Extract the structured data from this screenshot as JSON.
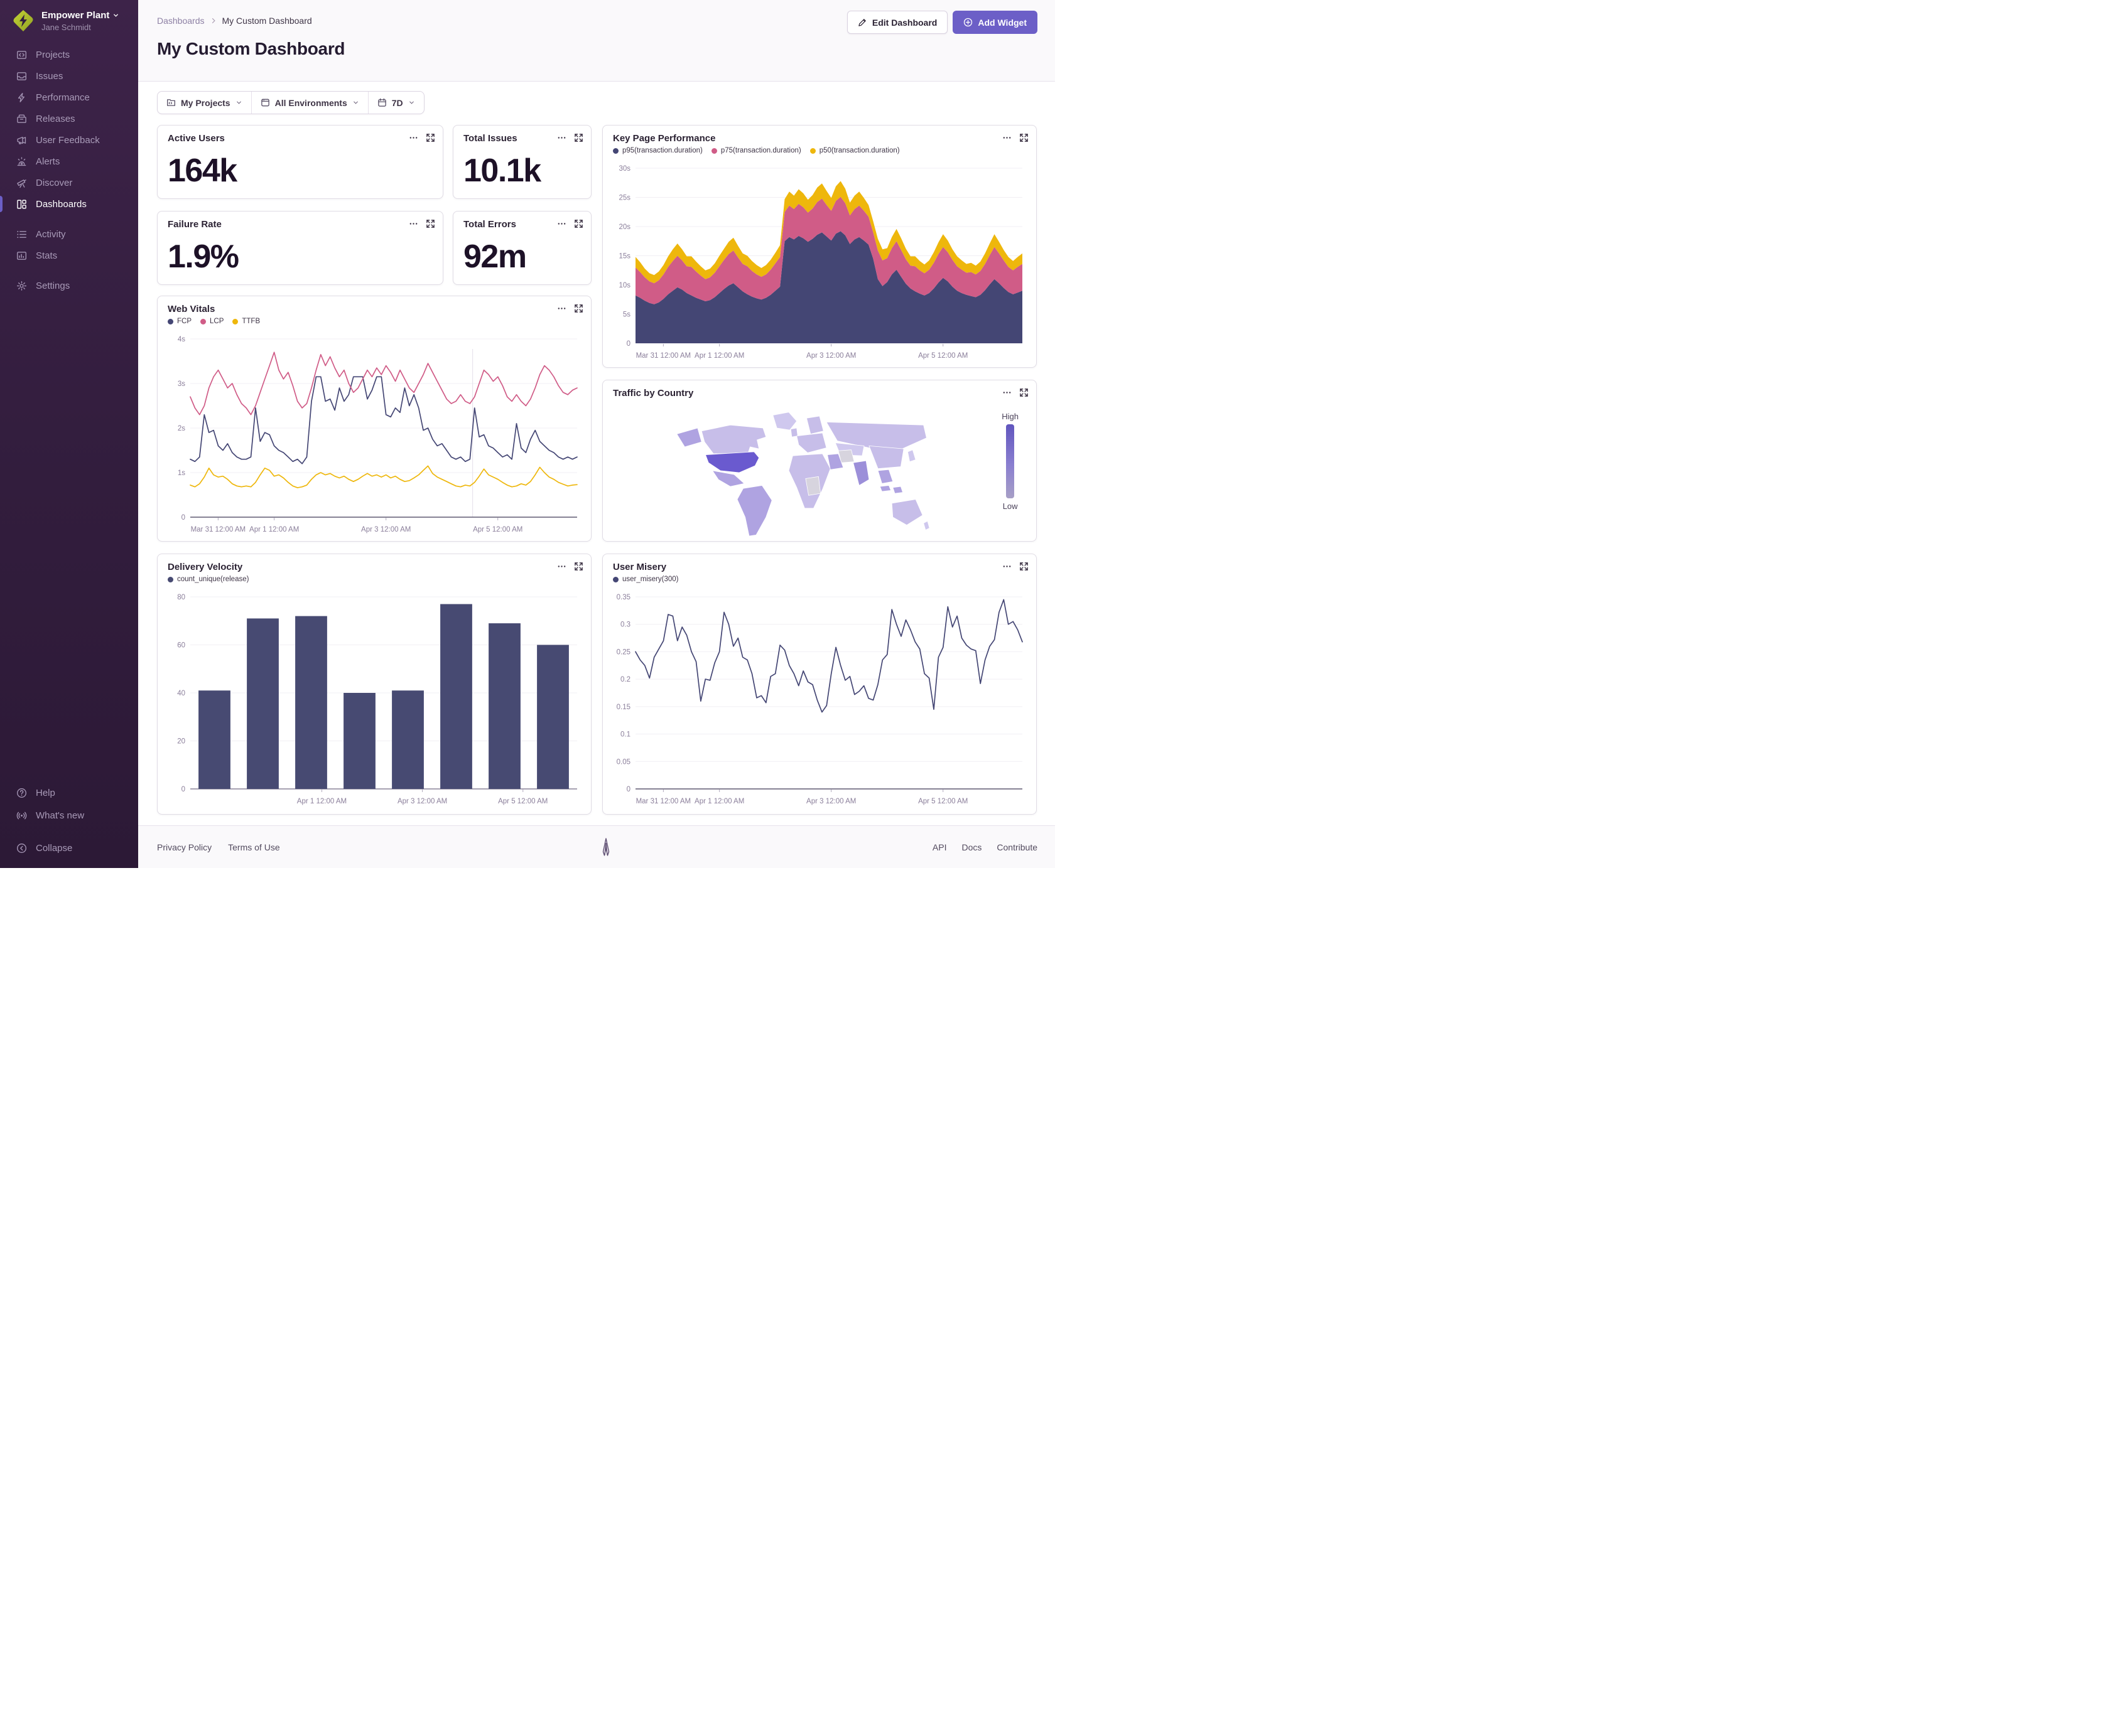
{
  "colors": {
    "accent": "#6C5FC7",
    "navy": "#444674",
    "pink": "#D05C87",
    "gold": "#EEB70C",
    "bar": "#474A72"
  },
  "sidebar": {
    "org_name": "Empower Plant",
    "user_name": "Jane Schmidt",
    "items": [
      {
        "label": "Projects"
      },
      {
        "label": "Issues"
      },
      {
        "label": "Performance"
      },
      {
        "label": "Releases"
      },
      {
        "label": "User Feedback"
      },
      {
        "label": "Alerts"
      },
      {
        "label": "Discover"
      },
      {
        "label": "Dashboards"
      },
      {
        "label": "Activity"
      },
      {
        "label": "Stats"
      },
      {
        "label": "Settings"
      }
    ],
    "footer_items": [
      {
        "label": "Help"
      },
      {
        "label": "What's new"
      },
      {
        "label": "Collapse"
      }
    ]
  },
  "header": {
    "breadcrumb_parent": "Dashboards",
    "breadcrumb_current": "My Custom Dashboard",
    "title": "My Custom Dashboard",
    "edit_button": "Edit Dashboard",
    "add_button": "Add Widget"
  },
  "filters": {
    "projects": "My Projects",
    "environments": "All Environments",
    "date_range": "7D"
  },
  "stat_cards": [
    {
      "title": "Active Users",
      "value": "164k"
    },
    {
      "title": "Total Issues",
      "value": "10.1k"
    },
    {
      "title": "Failure Rate",
      "value": "1.9%"
    },
    {
      "title": "Total Errors",
      "value": "92m"
    }
  ],
  "footer": {
    "links_left": [
      "Privacy Policy",
      "Terms of Use"
    ],
    "links_right": [
      "API",
      "Docs",
      "Contribute"
    ]
  },
  "chart_data": [
    {
      "id": "key_page_performance",
      "type": "area",
      "stacked": true,
      "title": "Key Page Performance",
      "ylabel": "seconds",
      "ylim": [
        0,
        30
      ],
      "y_ticks": [
        {
          "v": 0,
          "label": "0"
        },
        {
          "v": 5,
          "label": "5s"
        },
        {
          "v": 10,
          "label": "10s"
        },
        {
          "v": 15,
          "label": "15s"
        },
        {
          "v": 20,
          "label": "20s"
        },
        {
          "v": 25,
          "label": "25s"
        },
        {
          "v": 30,
          "label": "30s"
        }
      ],
      "x_ticks": [
        {
          "f": 0.072,
          "label": "Mar 31 12:00 AM"
        },
        {
          "f": 0.217,
          "label": "Apr 1 12:00 AM"
        },
        {
          "f": 0.506,
          "label": "Apr 3 12:00 AM"
        },
        {
          "f": 0.795,
          "label": "Apr 5 12:00 AM"
        }
      ],
      "series": [
        {
          "name": "p95(transaction.duration)",
          "color": "#444674",
          "values": [
            8.2,
            7.8,
            7.3,
            6.9,
            6.7,
            7.0,
            7.6,
            8.4,
            9.0,
            9.6,
            9.2,
            8.6,
            8.2,
            7.8,
            7.5,
            7.2,
            7.4,
            7.9,
            8.6,
            9.3,
            9.9,
            10.3,
            9.6,
            8.9,
            8.4,
            8.0,
            7.7,
            7.5,
            7.8,
            8.3,
            9.0,
            9.7,
            17.5,
            18.2,
            17.8,
            18.4,
            18.0,
            17.4,
            17.9,
            18.6,
            19.0,
            18.3,
            17.6,
            18.8,
            19.2,
            18.5,
            17.0,
            17.8,
            18.2,
            17.6,
            16.9,
            14.5,
            11.0,
            9.8,
            10.5,
            11.8,
            12.6,
            11.4,
            10.2,
            9.4,
            8.9,
            8.5,
            8.2,
            8.6,
            9.4,
            10.4,
            11.2,
            10.6,
            9.7,
            9.0,
            8.6,
            8.3,
            8.1,
            7.9,
            8.3,
            9.1,
            10.1,
            11.0,
            10.3,
            9.5,
            8.8,
            8.4,
            8.7,
            9.0
          ]
        },
        {
          "name": "p75(transaction.duration)",
          "color": "#D05C87",
          "values": [
            4.8,
            4.4,
            4.0,
            3.7,
            3.6,
            3.8,
            4.2,
            4.7,
            5.1,
            5.4,
            5.0,
            4.6,
            4.9,
            4.5,
            4.1,
            3.8,
            3.9,
            4.2,
            4.6,
            5.0,
            5.4,
            5.6,
            5.1,
            4.7,
            4.8,
            4.4,
            4.1,
            3.9,
            4.0,
            4.3,
            4.7,
            5.1,
            5.0,
            5.4,
            5.2,
            5.5,
            5.3,
            5.0,
            5.2,
            5.6,
            5.8,
            5.4,
            5.1,
            5.6,
            5.9,
            5.5,
            4.9,
            5.2,
            5.4,
            5.1,
            4.8,
            4.5,
            4.9,
            4.4,
            4.1,
            4.5,
            4.9,
            4.6,
            4.2,
            3.9,
            4.3,
            4.0,
            3.8,
            4.0,
            4.4,
            4.9,
            5.3,
            5.0,
            4.6,
            4.2,
            4.0,
            3.8,
            4.1,
            3.9,
            4.1,
            4.5,
            5.0,
            5.5,
            5.1,
            4.7,
            4.3,
            4.1,
            4.4,
            4.6
          ]
        },
        {
          "name": "p50(transaction.duration)",
          "color": "#EEB70C",
          "values": [
            1.8,
            1.7,
            1.5,
            1.4,
            1.4,
            1.5,
            1.6,
            1.8,
            2.0,
            2.1,
            1.9,
            1.7,
            1.8,
            1.7,
            1.6,
            1.5,
            1.5,
            1.6,
            1.8,
            1.9,
            2.1,
            2.2,
            2.0,
            1.8,
            1.8,
            1.7,
            1.6,
            1.5,
            1.6,
            1.7,
            1.8,
            2.0,
            2.2,
            2.4,
            2.3,
            2.5,
            2.4,
            2.2,
            2.3,
            2.5,
            2.6,
            2.4,
            2.2,
            2.5,
            2.7,
            2.5,
            2.2,
            2.3,
            2.4,
            2.2,
            2.0,
            1.9,
            2.0,
            1.9,
            1.7,
            1.9,
            2.1,
            2.0,
            1.8,
            1.6,
            1.7,
            1.6,
            1.5,
            1.6,
            1.8,
            2.0,
            2.2,
            2.0,
            1.8,
            1.7,
            1.6,
            1.5,
            1.6,
            1.5,
            1.6,
            1.8,
            2.0,
            2.2,
            2.0,
            1.8,
            1.7,
            1.6,
            1.7,
            1.8
          ]
        }
      ]
    },
    {
      "id": "web_vitals",
      "type": "line",
      "title": "Web Vitals",
      "ylim": [
        0,
        4
      ],
      "marker_f": 0.73,
      "y_ticks": [
        {
          "v": 0,
          "label": "0"
        },
        {
          "v": 1,
          "label": "1s"
        },
        {
          "v": 2,
          "label": "2s"
        },
        {
          "v": 3,
          "label": "3s"
        },
        {
          "v": 4,
          "label": "4s"
        }
      ],
      "x_ticks": [
        {
          "f": 0.072,
          "label": "Mar 31 12:00 AM"
        },
        {
          "f": 0.217,
          "label": "Apr 1 12:00 AM"
        },
        {
          "f": 0.506,
          "label": "Apr 3 12:00 AM"
        },
        {
          "f": 0.795,
          "label": "Apr 5 12:00 AM"
        }
      ],
      "series": [
        {
          "name": "FCP",
          "color": "#444674",
          "values": [
            1.3,
            1.25,
            1.35,
            2.3,
            1.9,
            1.95,
            1.6,
            1.5,
            1.65,
            1.45,
            1.35,
            1.3,
            1.3,
            1.35,
            2.45,
            1.7,
            1.9,
            1.85,
            1.6,
            1.5,
            1.45,
            1.35,
            1.25,
            1.3,
            1.2,
            1.35,
            2.6,
            3.15,
            3.15,
            2.6,
            2.65,
            2.4,
            2.9,
            2.6,
            2.75,
            3.15,
            3.15,
            3.15,
            2.65,
            2.85,
            3.15,
            3.15,
            2.3,
            2.25,
            2.45,
            2.35,
            2.9,
            2.5,
            2.75,
            2.45,
            1.95,
            2.0,
            1.75,
            1.6,
            1.65,
            1.5,
            1.35,
            1.3,
            1.35,
            1.25,
            1.3,
            2.45,
            1.8,
            1.85,
            1.6,
            1.55,
            1.45,
            1.35,
            1.4,
            1.3,
            2.1,
            1.55,
            1.45,
            1.75,
            1.95,
            1.7,
            1.6,
            1.5,
            1.45,
            1.35,
            1.3,
            1.35,
            1.3,
            1.35
          ]
        },
        {
          "name": "LCP",
          "color": "#D05C87",
          "values": [
            2.7,
            2.45,
            2.3,
            2.5,
            2.9,
            3.15,
            3.3,
            3.1,
            2.9,
            3.0,
            2.75,
            2.55,
            2.45,
            2.3,
            2.5,
            2.8,
            3.1,
            3.4,
            3.7,
            3.3,
            3.1,
            3.25,
            2.95,
            2.6,
            2.45,
            2.55,
            2.9,
            3.3,
            3.65,
            3.4,
            3.6,
            3.35,
            3.15,
            3.3,
            3.0,
            2.8,
            2.9,
            3.1,
            3.3,
            3.15,
            3.35,
            3.2,
            3.4,
            3.25,
            3.05,
            3.3,
            3.1,
            2.9,
            2.8,
            3.0,
            3.2,
            3.45,
            3.25,
            3.05,
            2.85,
            2.65,
            2.55,
            2.6,
            2.75,
            2.6,
            2.55,
            2.7,
            3.0,
            3.3,
            3.2,
            3.05,
            3.15,
            2.95,
            2.7,
            2.6,
            2.75,
            2.6,
            2.5,
            2.65,
            2.9,
            3.2,
            3.4,
            3.3,
            3.15,
            2.95,
            2.8,
            2.75,
            2.85,
            2.9
          ]
        },
        {
          "name": "TTFB",
          "color": "#EEB70C",
          "values": [
            0.72,
            0.68,
            0.75,
            0.9,
            1.1,
            0.95,
            0.9,
            0.92,
            0.85,
            0.75,
            0.7,
            0.68,
            0.7,
            0.68,
            0.78,
            0.95,
            1.1,
            1.05,
            0.92,
            0.95,
            0.88,
            0.78,
            0.7,
            0.66,
            0.68,
            0.72,
            0.85,
            0.95,
            1.0,
            0.95,
            0.98,
            0.92,
            0.88,
            0.92,
            0.85,
            0.8,
            0.85,
            0.92,
            0.98,
            0.92,
            0.95,
            0.9,
            0.95,
            0.88,
            0.92,
            0.85,
            0.8,
            0.82,
            0.88,
            0.95,
            1.05,
            1.15,
            0.98,
            0.9,
            0.85,
            0.8,
            0.75,
            0.7,
            0.68,
            0.72,
            0.7,
            0.78,
            0.92,
            1.08,
            0.95,
            0.9,
            0.85,
            0.78,
            0.72,
            0.68,
            0.7,
            0.75,
            0.72,
            0.8,
            0.95,
            1.12,
            1.0,
            0.9,
            0.85,
            0.78,
            0.74,
            0.7,
            0.72,
            0.73
          ]
        }
      ]
    },
    {
      "id": "traffic_map",
      "type": "choropleth_map",
      "title": "Traffic by Country",
      "legend_high": "High",
      "legend_low": "Low",
      "palette": {
        "base": "#C7BEE9",
        "light": "#CFC8EE",
        "mid": "#AFA3E1",
        "middark": "#9C8FD9",
        "dark": "#6A5ACF",
        "gray": "#D7D4DE"
      },
      "regions": [
        {
          "id": "greenland",
          "level": "light"
        },
        {
          "id": "canada",
          "level": "base"
        },
        {
          "id": "alaska",
          "level": "mid"
        },
        {
          "id": "us",
          "level": "dark"
        },
        {
          "id": "mexico",
          "level": "mid"
        },
        {
          "id": "south_america",
          "level": "mid"
        },
        {
          "id": "scandinavia",
          "level": "base"
        },
        {
          "id": "uk",
          "level": "base"
        },
        {
          "id": "europe",
          "level": "base"
        },
        {
          "id": "africa",
          "level": "base"
        },
        {
          "id": "africa_gray",
          "level": "gray"
        },
        {
          "id": "russia",
          "level": "base"
        },
        {
          "id": "central_asia",
          "level": "light"
        },
        {
          "id": "iran",
          "level": "gray"
        },
        {
          "id": "saudi",
          "level": "mid"
        },
        {
          "id": "india",
          "level": "middark"
        },
        {
          "id": "china",
          "level": "base"
        },
        {
          "id": "se_asia",
          "level": "mid"
        },
        {
          "id": "japan",
          "level": "light"
        },
        {
          "id": "indonesia",
          "level": "mid"
        },
        {
          "id": "australia",
          "level": "base"
        },
        {
          "id": "new_zealand",
          "level": "light"
        }
      ]
    },
    {
      "id": "delivery_velocity",
      "type": "bar",
      "title": "Delivery Velocity",
      "color": "#474A72",
      "ylim": [
        0,
        80
      ],
      "y_ticks": [
        {
          "v": 0,
          "label": "0"
        },
        {
          "v": 20,
          "label": "20"
        },
        {
          "v": 40,
          "label": "40"
        },
        {
          "v": 60,
          "label": "60"
        },
        {
          "v": 80,
          "label": "80"
        }
      ],
      "x_ticks": [
        {
          "f": 0.34,
          "label": "Apr 1 12:00 AM"
        },
        {
          "f": 0.6,
          "label": "Apr 3 12:00 AM"
        },
        {
          "f": 0.86,
          "label": "Apr 5 12:00 AM"
        }
      ],
      "series": [
        {
          "name": "count_unique(release)",
          "color": "#474A72"
        }
      ],
      "values": [
        41,
        71,
        72,
        40,
        41,
        77,
        69,
        60
      ]
    },
    {
      "id": "user_misery",
      "type": "line",
      "title": "User Misery",
      "ylim": [
        0,
        0.35
      ],
      "y_ticks": [
        {
          "v": 0,
          "label": "0"
        },
        {
          "v": 0.05,
          "label": "0.05"
        },
        {
          "v": 0.1,
          "label": "0.1"
        },
        {
          "v": 0.15,
          "label": "0.15"
        },
        {
          "v": 0.2,
          "label": "0.2"
        },
        {
          "v": 0.25,
          "label": "0.25"
        },
        {
          "v": 0.3,
          "label": "0.3"
        },
        {
          "v": 0.35,
          "label": "0.35"
        }
      ],
      "x_ticks": [
        {
          "f": 0.072,
          "label": "Mar 31 12:00 AM"
        },
        {
          "f": 0.217,
          "label": "Apr 1 12:00 AM"
        },
        {
          "f": 0.506,
          "label": "Apr 3 12:00 AM"
        },
        {
          "f": 0.795,
          "label": "Apr 5 12:00 AM"
        }
      ],
      "series": [
        {
          "name": "user_misery(300)",
          "color": "#444674",
          "values": [
            0.25,
            0.235,
            0.225,
            0.202,
            0.24,
            0.255,
            0.27,
            0.318,
            0.315,
            0.27,
            0.295,
            0.28,
            0.25,
            0.232,
            0.16,
            0.2,
            0.198,
            0.23,
            0.25,
            0.322,
            0.3,
            0.26,
            0.275,
            0.24,
            0.235,
            0.21,
            0.166,
            0.17,
            0.157,
            0.205,
            0.21,
            0.262,
            0.253,
            0.225,
            0.21,
            0.188,
            0.215,
            0.195,
            0.19,
            0.162,
            0.14,
            0.152,
            0.21,
            0.258,
            0.225,
            0.198,
            0.205,
            0.172,
            0.178,
            0.188,
            0.165,
            0.162,
            0.19,
            0.235,
            0.245,
            0.327,
            0.3,
            0.278,
            0.308,
            0.29,
            0.268,
            0.255,
            0.21,
            0.202,
            0.145,
            0.24,
            0.258,
            0.332,
            0.295,
            0.315,
            0.275,
            0.262,
            0.255,
            0.252,
            0.192,
            0.235,
            0.26,
            0.272,
            0.322,
            0.345,
            0.3,
            0.305,
            0.29,
            0.268
          ]
        }
      ]
    }
  ]
}
